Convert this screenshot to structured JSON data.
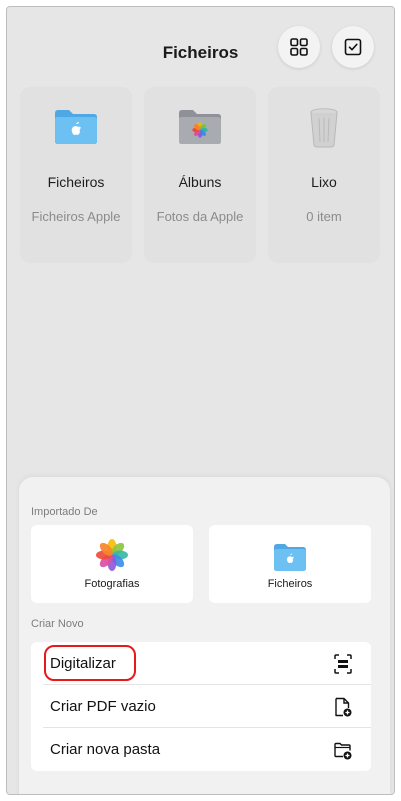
{
  "header": {
    "title": "Ficheiros",
    "grid_icon": "grid-view-icon",
    "select_icon": "checkbox-select-icon"
  },
  "locations": [
    {
      "name": "Ficheiros",
      "subtitle": "Ficheiros Apple",
      "icon": "blue-folder-apple-icon"
    },
    {
      "name": "Álbuns",
      "subtitle": "Fotos da Apple",
      "icon": "gray-folder-photos-icon"
    },
    {
      "name": "Lixo",
      "subtitle": "0 item",
      "icon": "trash-icon"
    }
  ],
  "sheet": {
    "imported_from_label": "Importado De",
    "sources": [
      {
        "label": "Fotografias",
        "icon": "photos-app-icon"
      },
      {
        "label": "Ficheiros",
        "icon": "files-folder-icon"
      }
    ],
    "create_new_label": "Criar Novo",
    "actions": [
      {
        "label": "Digitalizar",
        "icon": "scan-document-icon",
        "highlighted": true
      },
      {
        "label": "Criar PDF vazio",
        "icon": "new-pdf-icon"
      },
      {
        "label": "Criar nova pasta",
        "icon": "new-folder-icon"
      }
    ]
  },
  "colors": {
    "highlight": "#e8191b",
    "folder_blue": "#5ab4ec",
    "folder_gray": "#a3a7ac"
  }
}
